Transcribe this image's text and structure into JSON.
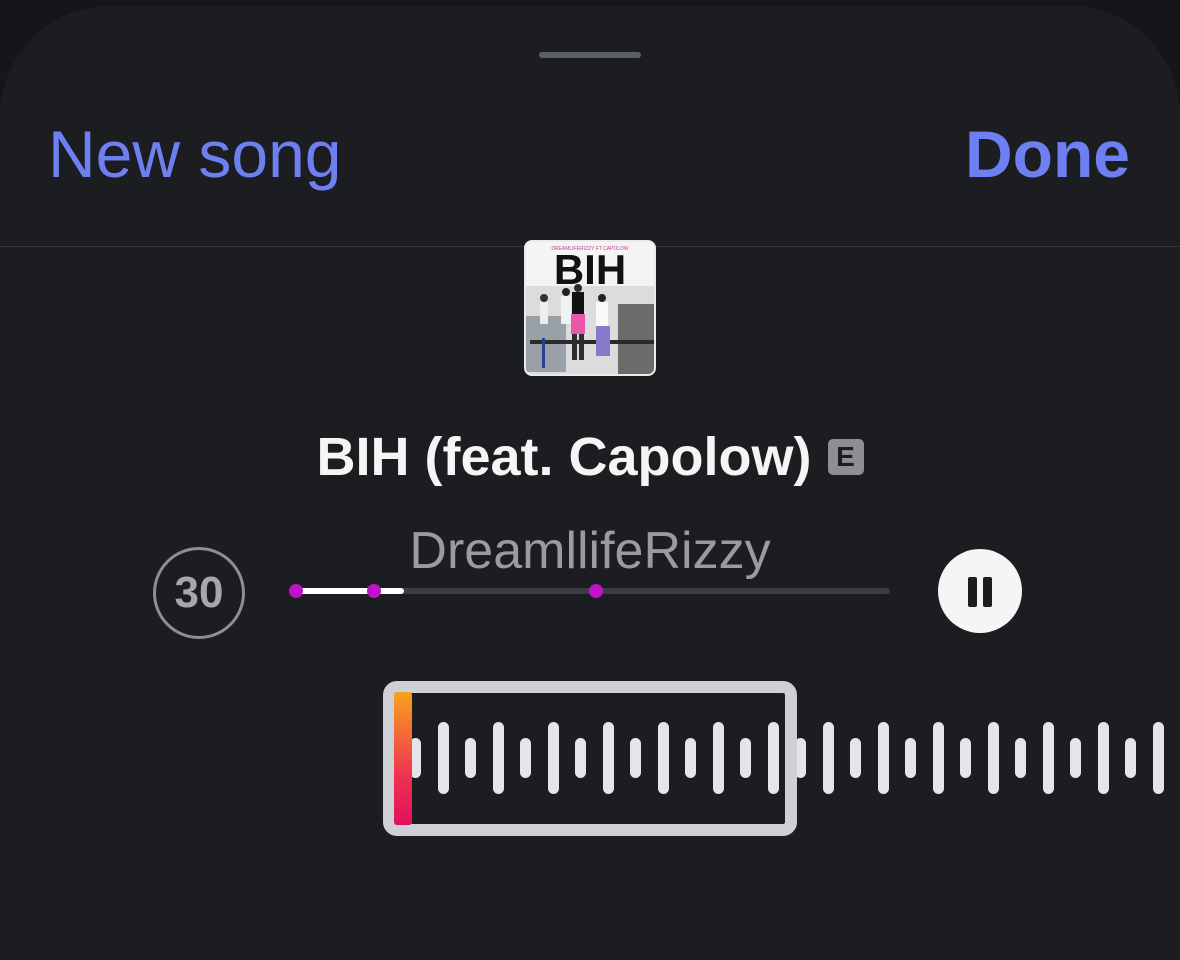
{
  "nav": {
    "left_label": "New song",
    "right_label": "Done"
  },
  "artwork": {
    "title_text": "BIH",
    "subtitle_text": "DREAMLIFERIZZY FT CAPOLOW"
  },
  "track": {
    "title": "BIH (feat. Capolow)",
    "explicit_badge": "E",
    "artist": "DreamllifeRizzy"
  },
  "controls": {
    "skip_label": "30",
    "progress_fraction": 0.19,
    "markers_fraction": [
      0.01,
      0.14,
      0.51
    ],
    "pause_icon": "pause-icon"
  },
  "colors": {
    "accent": "#6e7ff2",
    "marker": "#c012c8",
    "playhead_top": "#f7a21d",
    "playhead_bottom": "#e0115a"
  }
}
